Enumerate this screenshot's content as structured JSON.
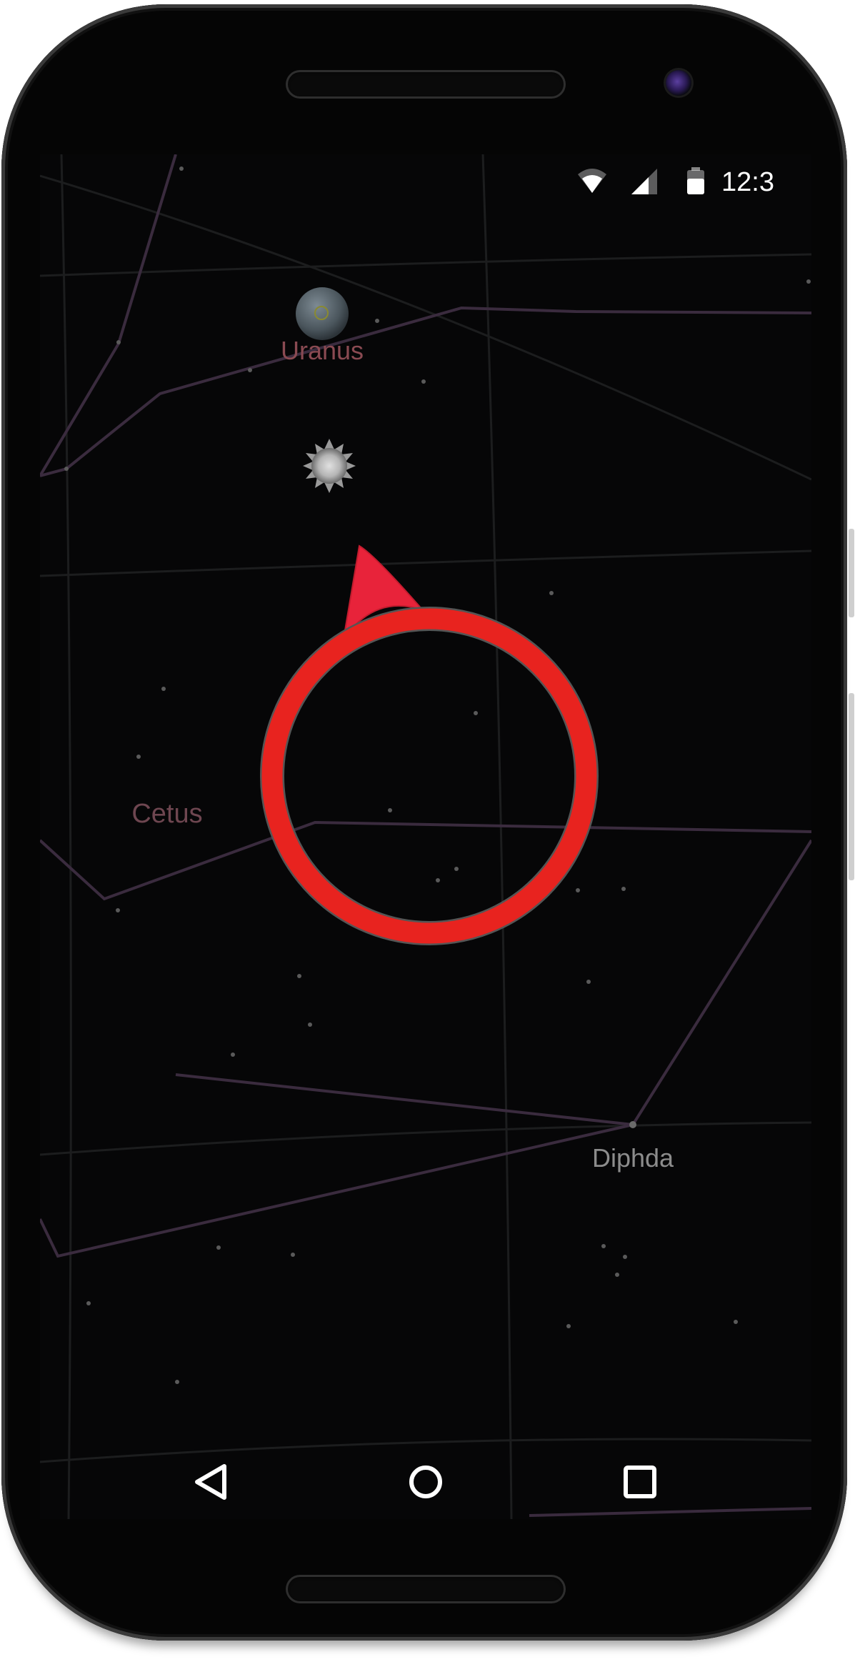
{
  "status_bar": {
    "time": "12:3",
    "icons": [
      "wifi-icon",
      "cell-signal-icon",
      "battery-icon"
    ]
  },
  "sky_labels": {
    "planet": "Uranus",
    "constellation": "Cetus",
    "star": "Diphda"
  },
  "colors": {
    "background": "#060607",
    "constellation_line": "#3a2b3e",
    "planet_label": "#8a4a52",
    "constellation_label": "#6e4650",
    "star_label": "#8c8c8c",
    "target_ring": "#e8231f",
    "pointer": "#e8233a"
  },
  "nav_bar": {
    "buttons": [
      "back-icon",
      "home-icon",
      "recents-icon"
    ]
  }
}
